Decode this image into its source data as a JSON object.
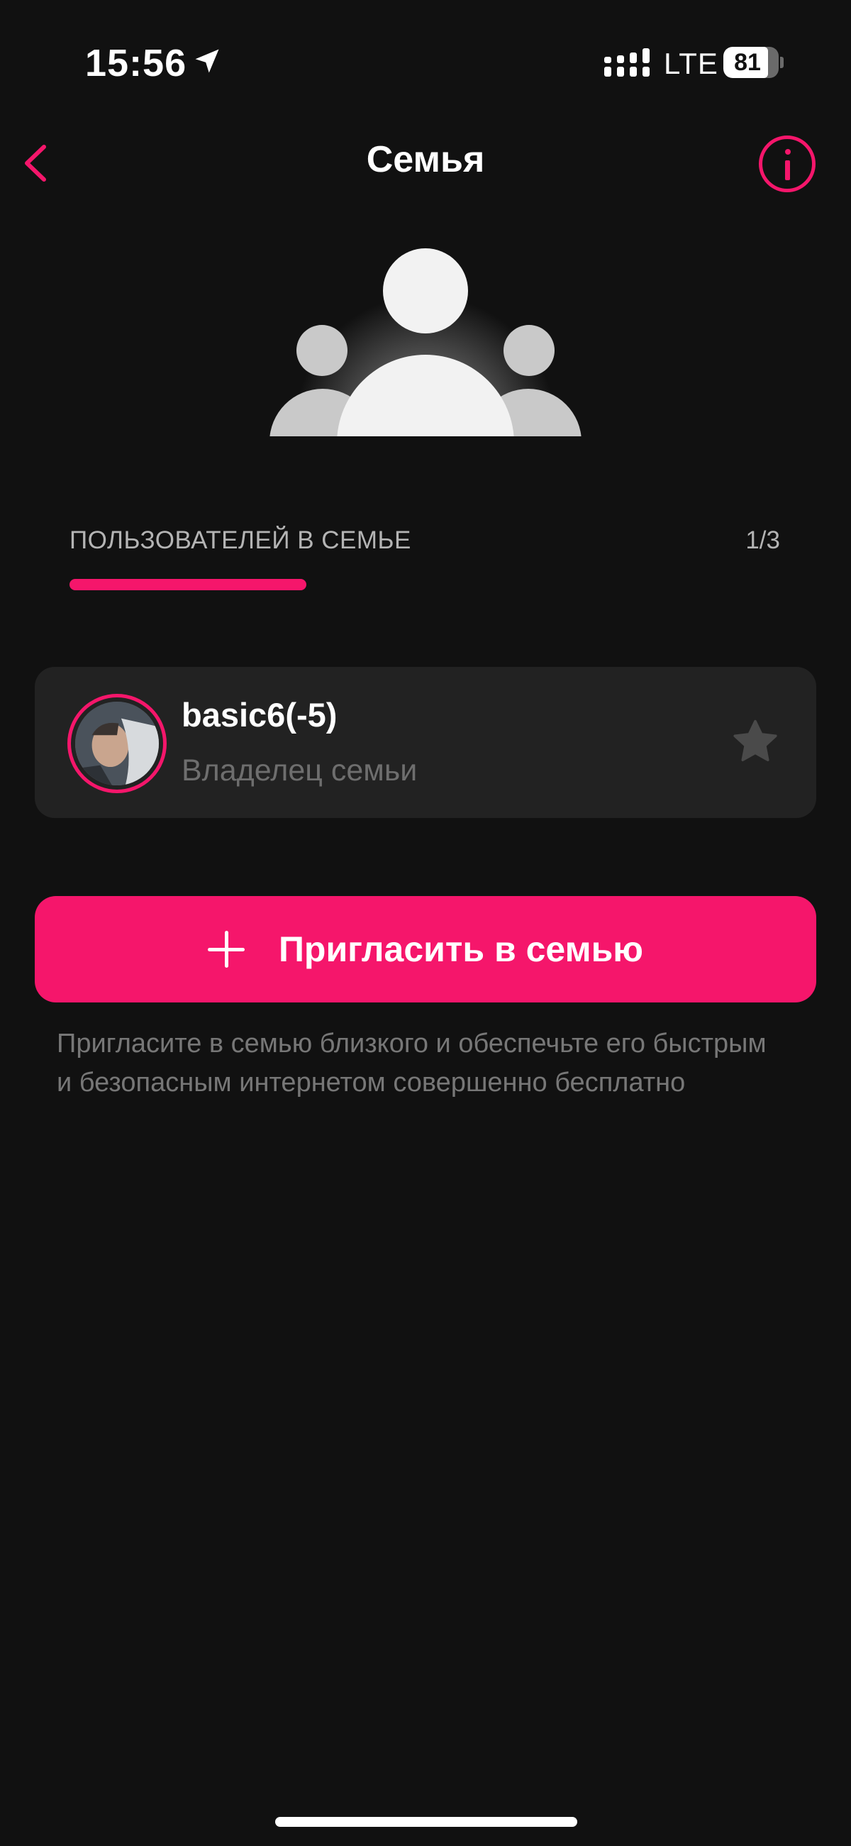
{
  "status_bar": {
    "time": "15:56",
    "network": "LTE",
    "battery_level": "81"
  },
  "header": {
    "title": "Семья"
  },
  "family": {
    "count_label": "ПОЛЬЗОВАТЕЛЕЙ В СЕМЬЕ",
    "count_value": "1/3",
    "members_fraction": 0.333
  },
  "members": [
    {
      "name": "basic6(-5)",
      "role": "Владелец семьи",
      "is_owner": true
    }
  ],
  "invite": {
    "button_label": "Пригласить в семью",
    "description": "Пригласите в семью близкого и обеспечьте его быстрым и безопасным интернетом совершенно бесплатно"
  },
  "colors": {
    "accent": "#f5166b",
    "background": "#111111",
    "card": "#222222",
    "muted_text": "#777777"
  },
  "icons": {
    "back": "chevron-left-icon",
    "info": "info-icon",
    "hero": "family-group-icon",
    "owner": "star-icon",
    "add": "plus-icon",
    "location": "location-arrow-icon",
    "signal": "cellular-signal-icon"
  }
}
